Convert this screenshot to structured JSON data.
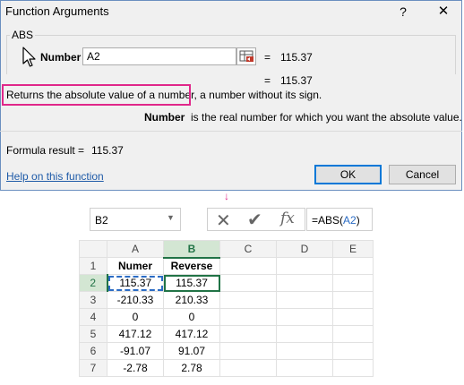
{
  "dialog": {
    "title": "Function Arguments",
    "help_glyph": "?",
    "close_glyph": "✕",
    "group_label": "ABS",
    "arg_label": "Number",
    "arg_value": "A2",
    "arg_eq": "=",
    "arg_result": "115.37",
    "result_eq": "=",
    "result_value": "115.37",
    "description": "Returns the absolute value of a number, a number without its sign.",
    "param_name": "Number",
    "param_desc": "is the real number for which you want the absolute value.",
    "formula_result_label": "Formula result =",
    "formula_result_value": "115.37",
    "help_link": "Help on this function",
    "ok_label": "OK",
    "cancel_label": "Cancel",
    "highlight_color": "#e0278a"
  },
  "arrow_glyph": "↓",
  "excel": {
    "name_box": "B2",
    "cancel_glyph": "✕",
    "enter_glyph": "✔",
    "fx_label": "fx",
    "formula_prefix": "=ABS(",
    "formula_ref": "A2",
    "formula_suffix": ")",
    "columns": [
      "A",
      "B",
      "C",
      "D",
      "E"
    ],
    "rows": [
      {
        "num": "1",
        "a": "Numer",
        "b": "Reverse"
      },
      {
        "num": "2",
        "a": "115.37",
        "b": "115.37"
      },
      {
        "num": "3",
        "a": "-210.33",
        "b": "210.33"
      },
      {
        "num": "4",
        "a": "0",
        "b": "0"
      },
      {
        "num": "5",
        "a": "417.12",
        "b": "417.12"
      },
      {
        "num": "6",
        "a": "-91.07",
        "b": "91.07"
      },
      {
        "num": "7",
        "a": "-2.78",
        "b": "2.78"
      }
    ],
    "accent": "#217346",
    "ref_color": "#2b6cc4"
  }
}
